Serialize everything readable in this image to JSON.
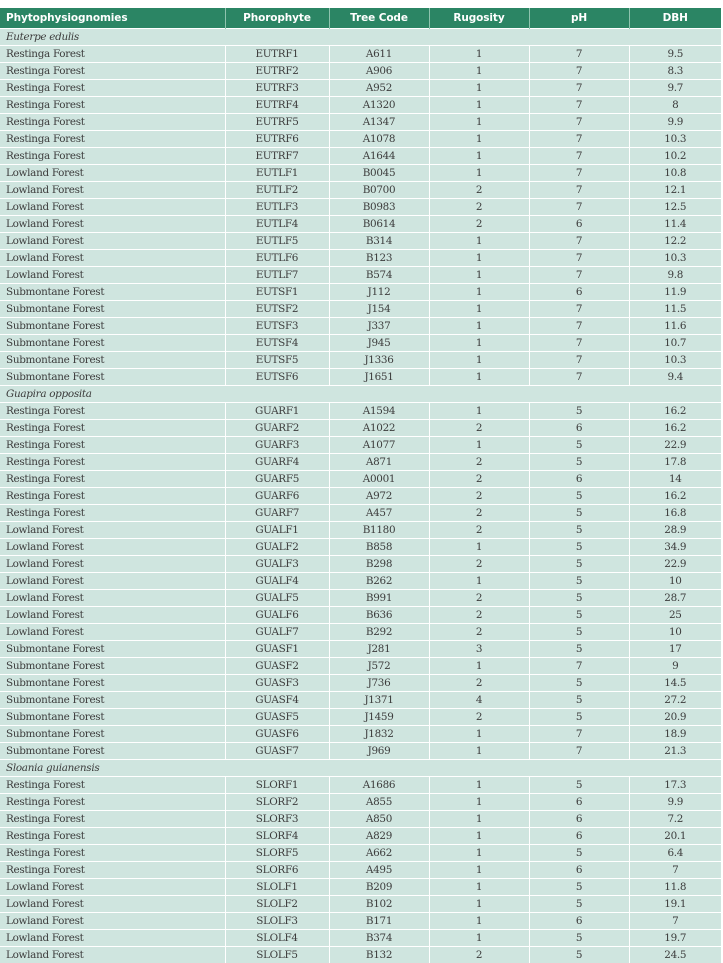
{
  "table": {
    "headers": [
      "Phytophysiognomies",
      "Phorophyte",
      "Tree Code",
      "Rugosity",
      "pH",
      "DBH"
    ],
    "colors": {
      "header_bg": "#2b8564",
      "row_bg": "#cfe5df",
      "divider": "#ffffff"
    },
    "groups": [
      {
        "species": "Euterpe edulis",
        "rows": [
          [
            "Restinga Forest",
            "EUTRF1",
            "A611",
            "1",
            "7",
            "9.5"
          ],
          [
            "Restinga Forest",
            "EUTRF2",
            "A906",
            "1",
            "7",
            "8.3"
          ],
          [
            "Restinga Forest",
            "EUTRF3",
            "A952",
            "1",
            "7",
            "9.7"
          ],
          [
            "Restinga Forest",
            "EUTRF4",
            "A1320",
            "1",
            "7",
            "8"
          ],
          [
            "Restinga Forest",
            "EUTRF5",
            "A1347",
            "1",
            "7",
            "9.9"
          ],
          [
            "Restinga Forest",
            "EUTRF6",
            "A1078",
            "1",
            "7",
            "10.3"
          ],
          [
            "Restinga Forest",
            "EUTRF7",
            "A1644",
            "1",
            "7",
            "10.2"
          ],
          [
            "Lowland Forest",
            "EUTLF1",
            "B0045",
            "1",
            "7",
            "10.8"
          ],
          [
            "Lowland Forest",
            "EUTLF2",
            "B0700",
            "2",
            "7",
            "12.1"
          ],
          [
            "Lowland Forest",
            "EUTLF3",
            "B0983",
            "2",
            "7",
            "12.5"
          ],
          [
            "Lowland Forest",
            "EUTLF4",
            "B0614",
            "2",
            "6",
            "11.4"
          ],
          [
            "Lowland Forest",
            "EUTLF5",
            "B314",
            "1",
            "7",
            "12.2"
          ],
          [
            "Lowland Forest",
            "EUTLF6",
            "B123",
            "1",
            "7",
            "10.3"
          ],
          [
            "Lowland Forest",
            "EUTLF7",
            "B574",
            "1",
            "7",
            "9.8"
          ],
          [
            "Submontane Forest",
            "EUTSF1",
            "J112",
            "1",
            "6",
            "11.9"
          ],
          [
            "Submontane Forest",
            "EUTSF2",
            "J154",
            "1",
            "7",
            "11.5"
          ],
          [
            "Submontane Forest",
            "EUTSF3",
            "J337",
            "1",
            "7",
            "11.6"
          ],
          [
            "Submontane Forest",
            "EUTSF4",
            "J945",
            "1",
            "7",
            "10.7"
          ],
          [
            "Submontane Forest",
            "EUTSF5",
            "J1336",
            "1",
            "7",
            "10.3"
          ],
          [
            "Submontane Forest",
            "EUTSF6",
            "J1651",
            "1",
            "7",
            "9.4"
          ]
        ]
      },
      {
        "species": "Guapira opposita",
        "rows": [
          [
            "Restinga Forest",
            "GUARF1",
            "A1594",
            "1",
            "5",
            "16.2"
          ],
          [
            "Restinga Forest",
            "GUARF2",
            "A1022",
            "2",
            "6",
            "16.2"
          ],
          [
            "Restinga Forest",
            "GUARF3",
            "A1077",
            "1",
            "5",
            "22.9"
          ],
          [
            "Restinga Forest",
            "GUARF4",
            "A871",
            "2",
            "5",
            "17.8"
          ],
          [
            "Restinga Forest",
            "GUARF5",
            "A0001",
            "2",
            "6",
            "14"
          ],
          [
            "Restinga Forest",
            "GUARF6",
            "A972",
            "2",
            "5",
            "16.2"
          ],
          [
            "Restinga Forest",
            "GUARF7",
            "A457",
            "2",
            "5",
            "16.8"
          ],
          [
            "Lowland Forest",
            "GUALF1",
            "B1180",
            "2",
            "5",
            "28.9"
          ],
          [
            "Lowland Forest",
            "GUALF2",
            "B858",
            "1",
            "5",
            "34.9"
          ],
          [
            "Lowland Forest",
            "GUALF3",
            "B298",
            "2",
            "5",
            "22.9"
          ],
          [
            "Lowland Forest",
            "GUALF4",
            "B262",
            "1",
            "5",
            "10"
          ],
          [
            "Lowland Forest",
            "GUALF5",
            "B991",
            "2",
            "5",
            "28.7"
          ],
          [
            "Lowland Forest",
            "GUALF6",
            "B636",
            "2",
            "5",
            "25"
          ],
          [
            "Lowland Forest",
            "GUALF7",
            "B292",
            "2",
            "5",
            "10"
          ],
          [
            "Submontane Forest",
            "GUASF1",
            "J281",
            "3",
            "5",
            "17"
          ],
          [
            "Submontane Forest",
            "GUASF2",
            "J572",
            "1",
            "7",
            "9"
          ],
          [
            "Submontane Forest",
            "GUASF3",
            "J736",
            "2",
            "5",
            "14.5"
          ],
          [
            "Submontane Forest",
            "GUASF4",
            "J1371",
            "4",
            "5",
            "27.2"
          ],
          [
            "Submontane Forest",
            "GUASF5",
            "J1459",
            "2",
            "5",
            "20.9"
          ],
          [
            "Submontane Forest",
            "GUASF6",
            "J1832",
            "1",
            "7",
            "18.9"
          ],
          [
            "Submontane Forest",
            "GUASF7",
            "J969",
            "1",
            "7",
            "21.3"
          ]
        ]
      },
      {
        "species": "Sloania guianensis",
        "rows": [
          [
            "Restinga Forest",
            "SLORF1",
            "A1686",
            "1",
            "5",
            "17.3"
          ],
          [
            "Restinga Forest",
            "SLORF2",
            "A855",
            "1",
            "6",
            "9.9"
          ],
          [
            "Restinga Forest",
            "SLORF3",
            "A850",
            "1",
            "6",
            "7.2"
          ],
          [
            "Restinga Forest",
            "SLORF4",
            "A829",
            "1",
            "6",
            "20.1"
          ],
          [
            "Restinga Forest",
            "SLORF5",
            "A662",
            "1",
            "5",
            "6.4"
          ],
          [
            "Restinga Forest",
            "SLORF6",
            "A495",
            "1",
            "6",
            "7"
          ],
          [
            "Lowland Forest",
            "SLOLF1",
            "B209",
            "1",
            "5",
            "11.8"
          ],
          [
            "Lowland Forest",
            "SLOLF2",
            "B102",
            "1",
            "5",
            "19.1"
          ],
          [
            "Lowland Forest",
            "SLOLF3",
            "B171",
            "1",
            "6",
            "7"
          ],
          [
            "Lowland Forest",
            "SLOLF4",
            "B374",
            "1",
            "5",
            "19.7"
          ],
          [
            "Lowland Forest",
            "SLOLF5",
            "B132",
            "2",
            "5",
            "24.5"
          ]
        ]
      }
    ]
  }
}
